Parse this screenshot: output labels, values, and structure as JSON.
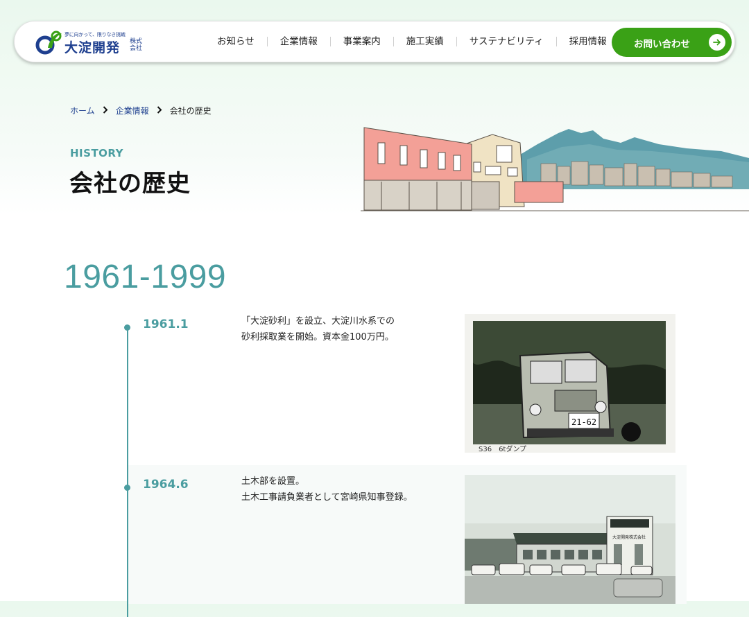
{
  "header": {
    "logo": {
      "tagline": "夢に向かって、限りなき挑戦",
      "name": "大淀開発",
      "suffix": "株式会社"
    },
    "nav": [
      "お知らせ",
      "企業情報",
      "事業案内",
      "施工実績",
      "サステナビリティ",
      "採用情報"
    ],
    "contact_label": "お問い合わせ",
    "accent_color": "#3aa116"
  },
  "breadcrumb": {
    "home": "ホーム",
    "parent": "企業情報",
    "current": "会社の歴史"
  },
  "page": {
    "eyebrow": "HISTORY",
    "title": "会社の歴史",
    "era": "1961-1999",
    "theme_color": "#4a9da0"
  },
  "timeline": [
    {
      "date": "1961.1",
      "lines": [
        "「大淀砂利」を設立、大淀川水系での",
        "砂利採取業を開始。資本金100万円。"
      ],
      "photo": {
        "plate": "21-62",
        "caption": "S36　6tダンプ"
      }
    },
    {
      "date": "1964.6",
      "lines": [
        "土木部を設置。",
        "土木工事請負業者として宮崎県知事登録。"
      ],
      "photo": {
        "sign": "大淀開発株式会社"
      }
    }
  ],
  "icons": [
    "logo-mark-icon",
    "chevron-right-icon",
    "arrow-right-icon"
  ]
}
